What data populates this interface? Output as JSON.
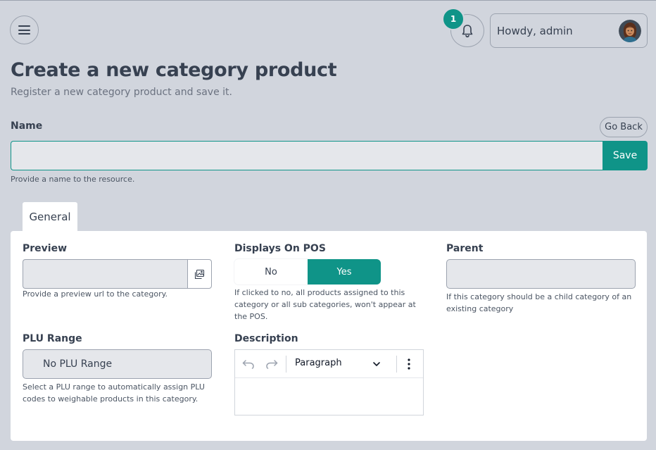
{
  "header": {
    "menu_icon": "hamburger-icon",
    "notification_count": "1",
    "greeting": "Howdy, admin"
  },
  "page": {
    "title": "Create a new category product",
    "subtitle": "Register a new category product and save it."
  },
  "name_field": {
    "label": "Name",
    "value": "",
    "help": "Provide a name to the resource.",
    "go_back_label": "Go Back",
    "save_label": "Save"
  },
  "tabs": [
    {
      "label": "General",
      "active": true
    }
  ],
  "form": {
    "preview": {
      "label": "Preview",
      "value": "",
      "help": "Provide a preview url to the category."
    },
    "displays_on_pos": {
      "label": "Displays On POS",
      "options": [
        "No",
        "Yes"
      ],
      "selected": "Yes",
      "help": "If clicked to no, all products assigned to this category or all sub categories, won't appear at the POS."
    },
    "parent": {
      "label": "Parent",
      "value": "",
      "help": "If this category should be a child category of an existing category"
    },
    "plu_range": {
      "label": "PLU Range",
      "value": "No PLU Range",
      "help": "Select a PLU range to automatically assign PLU codes to weighable products in this category."
    },
    "description": {
      "label": "Description",
      "block_type": "Paragraph",
      "value": ""
    }
  },
  "colors": {
    "accent": "#0f9488",
    "background": "#d1d5dd",
    "panel": "#ffffff",
    "input": "#e5e7eb"
  }
}
